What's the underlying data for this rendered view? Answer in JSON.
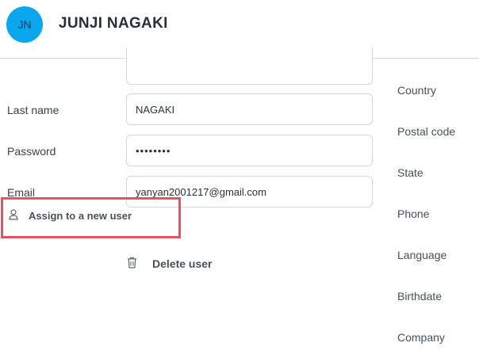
{
  "header": {
    "avatar_initials": "JN",
    "user_name": "JUNJI NAGAKI",
    "avatar_color": "#0aa7ee"
  },
  "form": {
    "last_name": {
      "label": "Last name",
      "value": "NAGAKI"
    },
    "password": {
      "label": "Password",
      "value": "••••••••"
    },
    "email": {
      "label": "Email",
      "value": "yanyan2001217@gmail.com"
    }
  },
  "actions": {
    "assign_label": "Assign to a new user",
    "delete_label": "Delete user"
  },
  "right_column": {
    "labels": [
      "Country",
      "Postal code",
      "State",
      "Phone",
      "Language",
      "Birthdate",
      "Company"
    ]
  },
  "highlight_color": "#e05561"
}
